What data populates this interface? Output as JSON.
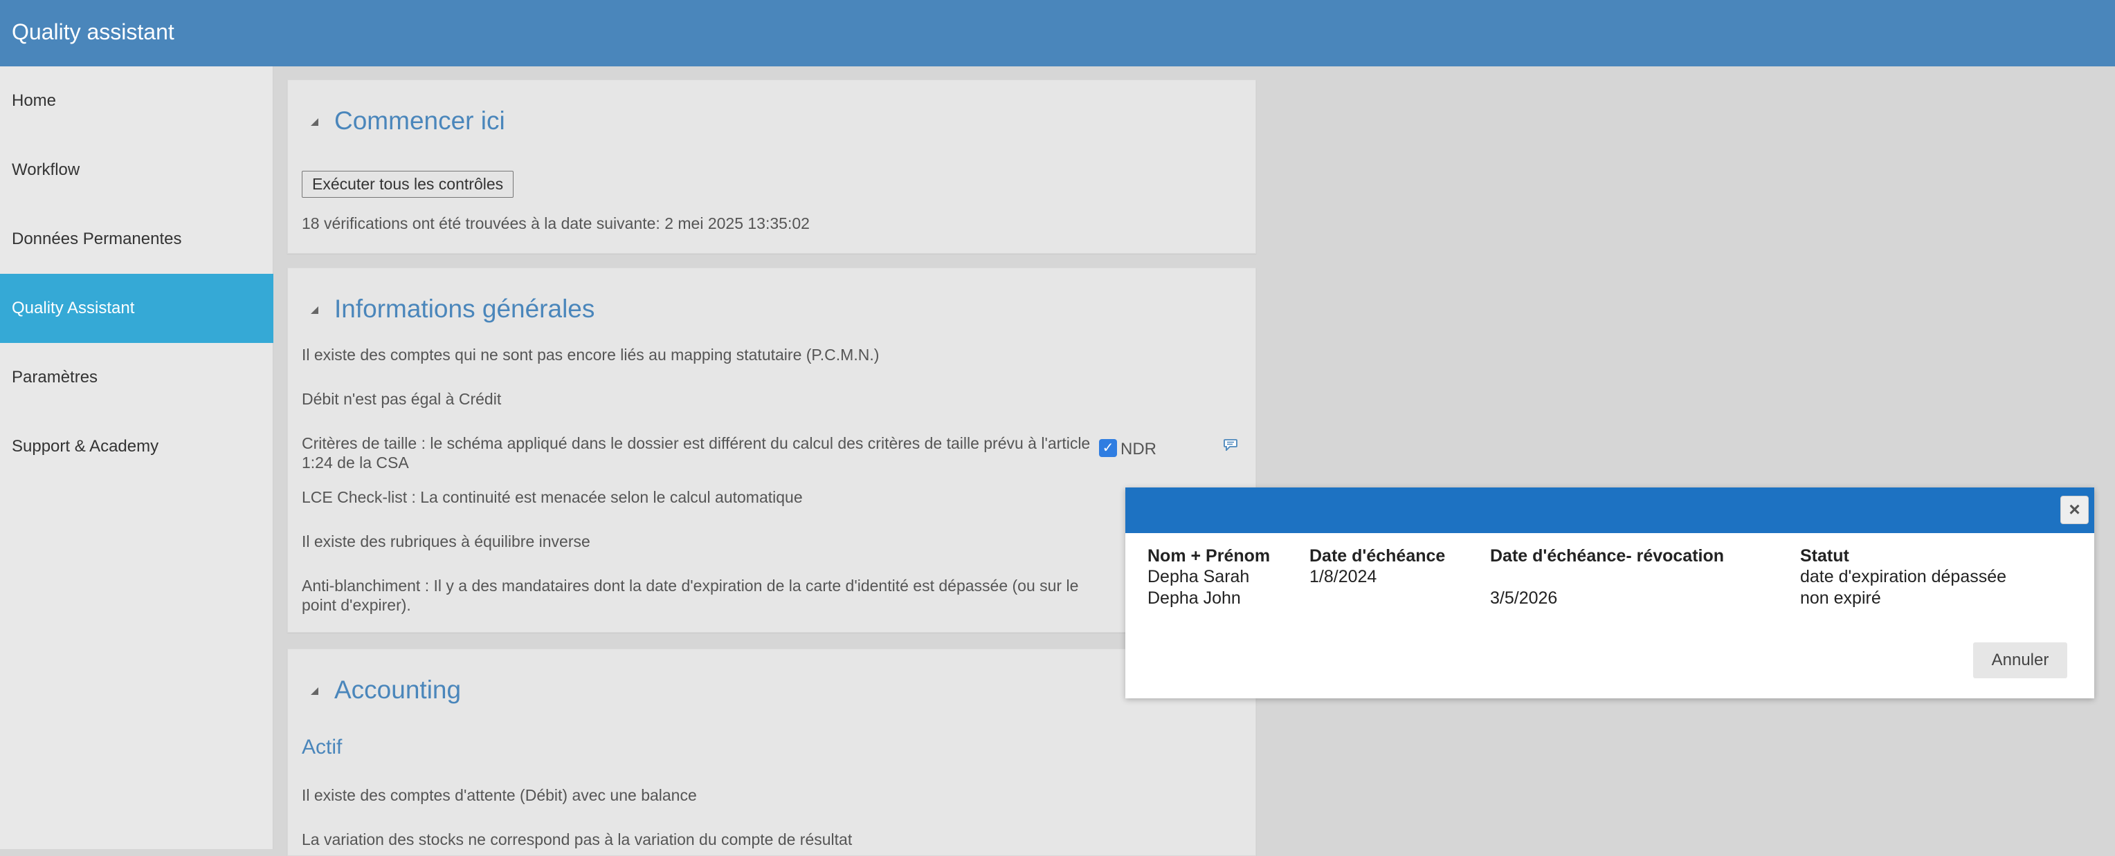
{
  "app": {
    "title": "Quality assistant"
  },
  "sidebar": {
    "items": [
      {
        "label": "Home"
      },
      {
        "label": "Workflow"
      },
      {
        "label": "Données Permanentes"
      },
      {
        "label": "Quality Assistant",
        "active": true
      },
      {
        "label": "Paramètres"
      },
      {
        "label": "Support & Academy"
      }
    ]
  },
  "panels": {
    "start": {
      "title": "Commencer ici",
      "run_button": "Exécuter tous les contrôles",
      "status": "18 vérifications ont été trouvées à la date suivante: 2 mei 2025 13:35:02"
    },
    "general": {
      "title": "Informations générales",
      "items": [
        "Il existe des comptes qui ne sont pas encore liés au mapping statutaire (P.C.M.N.)",
        "Débit n'est pas égal à Crédit",
        "Critères de taille : le schéma appliqué dans le dossier est différent du calcul des critères de taille prévu à l'article 1:24 de la CSA",
        "LCE Check-list : La continuité est menacée selon le calcul automatique",
        "Il existe des rubriques à équilibre inverse",
        "Anti-blanchiment : Il y a des mandataires dont la date d'expiration de la carte d'identité est dépassée (ou sur le point d'expirer)."
      ],
      "ndr_label": "NDR",
      "ndr_checked": true
    },
    "accounting": {
      "title": "Accounting",
      "subsection": "Actif",
      "items": [
        "Il existe des comptes d'attente (Débit) avec une balance",
        "La variation des stocks ne correspond pas à la variation du compte de résultat"
      ]
    }
  },
  "modal": {
    "headers": {
      "name": "Nom + Prénom",
      "due": "Date d'échéance",
      "revocation": "Date d'échéance- révocation",
      "status": "Statut"
    },
    "rows": [
      {
        "name": "Depha Sarah",
        "due": "1/8/2024",
        "revocation": "",
        "status": "date d'expiration dépassée"
      },
      {
        "name": "Depha John",
        "due": "",
        "revocation": "3/5/2026",
        "status": "non expiré"
      }
    ],
    "cancel_label": "Annuler",
    "close_icon": "close-icon"
  },
  "colors": {
    "brand": "#4a86bb",
    "active_nav": "#35a9d6",
    "modal_header": "#1d72c2"
  }
}
